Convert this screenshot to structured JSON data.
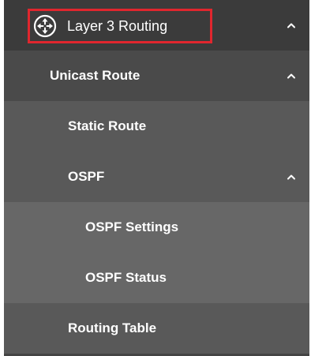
{
  "menu": {
    "layer3": {
      "label": "Layer 3 Routing",
      "icon": "router-icon",
      "expanded": true
    },
    "unicast": {
      "label": "Unicast Route",
      "expanded": true
    },
    "static_route": {
      "label": "Static Route"
    },
    "ospf": {
      "label": "OSPF",
      "expanded": true
    },
    "ospf_settings": {
      "label": "OSPF Settings"
    },
    "ospf_status": {
      "label": "OSPF Status"
    },
    "routing_table": {
      "label": "Routing Table"
    }
  },
  "colors": {
    "highlight_border": "#e0262e",
    "text": "#ffffff",
    "level0_bg": "#3b3b3b",
    "level1_bg": "#4a4a4a",
    "level2_bg": "#595959",
    "level3_bg": "#676767"
  }
}
